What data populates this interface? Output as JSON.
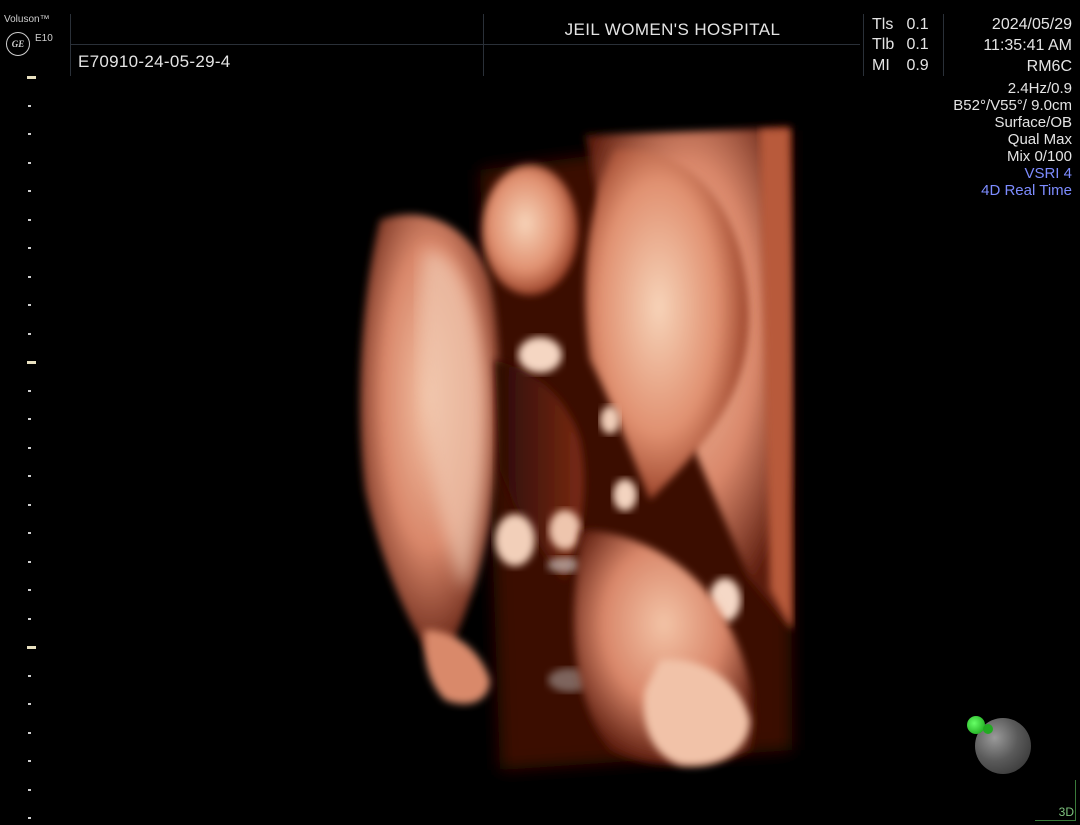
{
  "device": {
    "brand": "Voluson™",
    "logo_text": "GE",
    "model": "E10"
  },
  "header": {
    "patient_id": "E70910-24-05-29-4",
    "hospital": "JEIL WOMEN'S HOSPITAL",
    "date": "2024/05/29",
    "time": "11:35:41 AM",
    "probe": "RM6C"
  },
  "indices": [
    {
      "key": "Tls",
      "value": "0.1"
    },
    {
      "key": "Tlb",
      "value": "0.1"
    },
    {
      "key": "MI",
      "value": "0.9"
    }
  ],
  "params": [
    {
      "text": "2.4Hz/0.9",
      "color": "#e4e4e4"
    },
    {
      "text": "B52°/V55°/ 9.0cm",
      "color": "#e4e4e4"
    },
    {
      "text": "Surface/OB",
      "color": "#e4e4e4"
    },
    {
      "text": "Qual Max",
      "color": "#e4e4e4"
    },
    {
      "text": "Mix 0/100",
      "color": "#e4e4e4"
    },
    {
      "text": "VSRI 4",
      "color": "#7d8cff"
    },
    {
      "text": "4D Real Time",
      "color": "#7d8cff"
    }
  ],
  "corner_label": "3D",
  "colors": {
    "background": "#000000",
    "accent_blue": "#7d8cff",
    "render_skin": "#d9876a",
    "orientation_green": "#33cc33"
  }
}
